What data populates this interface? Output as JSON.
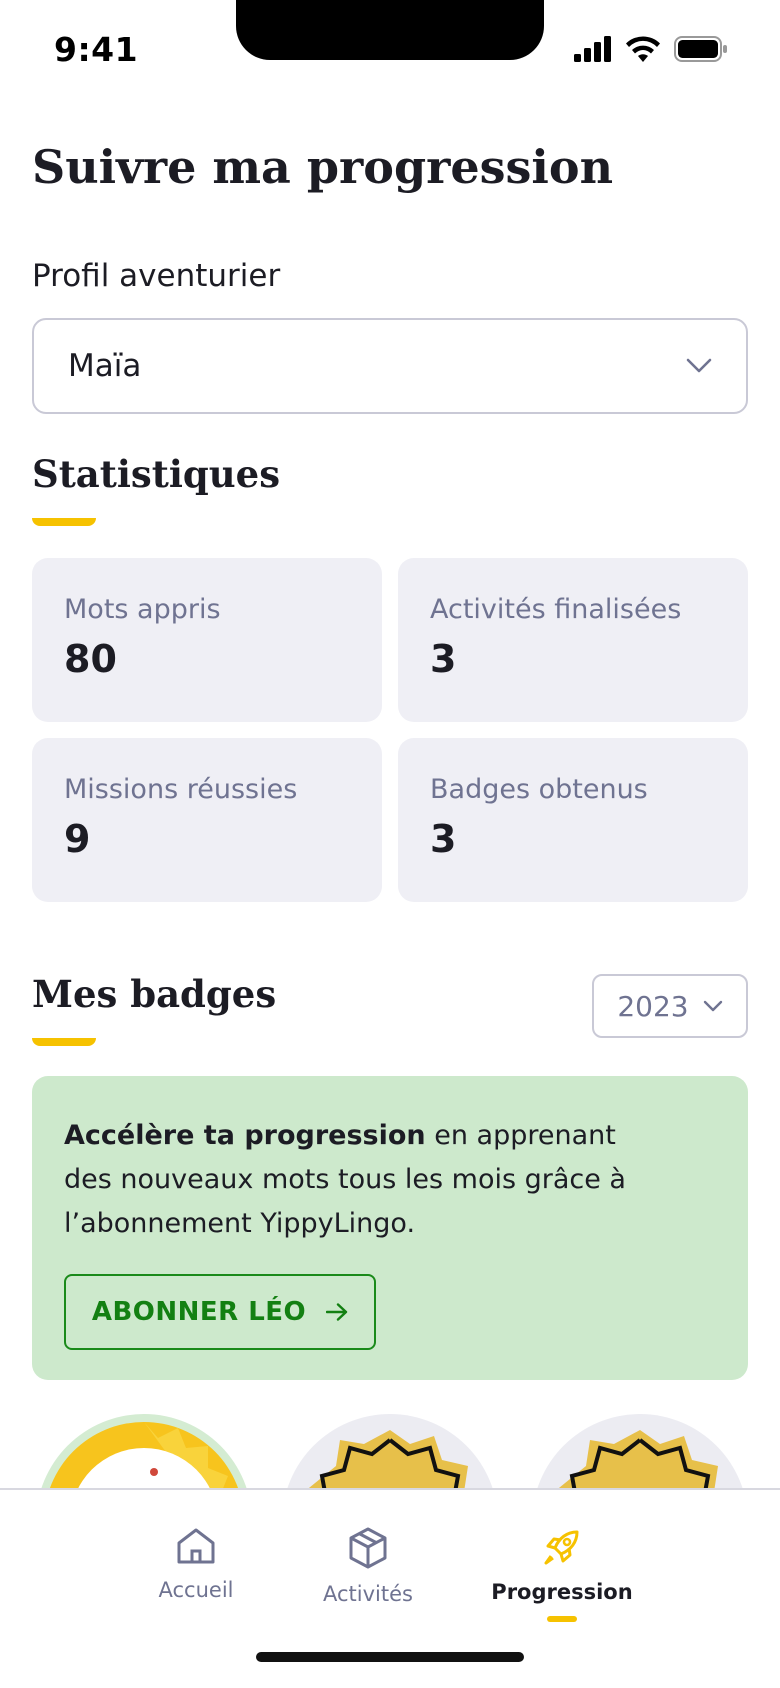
{
  "status_bar": {
    "time": "9:41"
  },
  "page": {
    "title": "Suivre ma progression"
  },
  "profile": {
    "label": "Profil aventurier",
    "selected": "Maïa"
  },
  "statistics": {
    "title": "Statistiques",
    "cards": [
      {
        "label": "Mots appris",
        "value": "80"
      },
      {
        "label": "Activités finalisées",
        "value": "3"
      },
      {
        "label": "Missions réussies",
        "value": "9"
      },
      {
        "label": "Badges obtenus",
        "value": "3"
      }
    ]
  },
  "badges": {
    "title": "Mes badges",
    "year": "2023",
    "promo": {
      "bold": "Accélère ta progression",
      "text": " en apprenant des nouveaux mots tous les mois grâce à l’abonnement YippyLingo.",
      "button": "ABONNER LÉO"
    }
  },
  "tabs": [
    {
      "label": "Accueil",
      "icon": "home-icon",
      "active": false
    },
    {
      "label": "Activités",
      "icon": "box-icon",
      "active": false
    },
    {
      "label": "Progression",
      "icon": "rocket-icon",
      "active": true
    }
  ],
  "colors": {
    "accent": "#f6c200",
    "promo_bg": "#cde9cc",
    "promo_green": "#138012",
    "card_bg": "#efeff5",
    "muted": "#6f7391"
  }
}
